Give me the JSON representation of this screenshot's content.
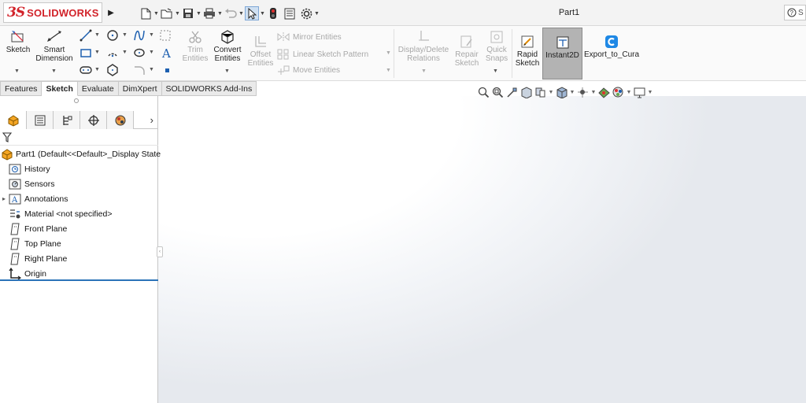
{
  "app": {
    "brand_prefix": "3S",
    "brand_name": "SOLIDWORKS",
    "document_title": "Part1",
    "help_hint": "S"
  },
  "ribbon": {
    "sketch": "Sketch",
    "smart_dimension_1": "Smart",
    "smart_dimension_2": "Dimension",
    "trim_1": "Trim",
    "trim_2": "Entities",
    "convert_1": "Convert",
    "convert_2": "Entities",
    "offset_1": "Offset",
    "offset_2": "Entities",
    "mirror": "Mirror Entities",
    "linear_pattern": "Linear Sketch Pattern",
    "move": "Move Entities",
    "display_delete_1": "Display/Delete",
    "display_delete_2": "Relations",
    "repair_1": "Repair",
    "repair_2": "Sketch",
    "quick_snaps_1": "Quick",
    "quick_snaps_2": "Snaps",
    "rapid_1": "Rapid",
    "rapid_2": "Sketch",
    "instant2d": "Instant2D",
    "export_cura": "Export_to_Cura"
  },
  "tabs": [
    "Features",
    "Sketch",
    "Evaluate",
    "DimXpert",
    "SOLIDWORKS Add-Ins"
  ],
  "active_tab": "Sketch",
  "tree": {
    "root": "Part1  (Default<<Default>_Display State",
    "items": [
      "History",
      "Sensors",
      "Annotations",
      "Material <not specified>",
      "Front Plane",
      "Top Plane",
      "Right Plane",
      "Origin"
    ]
  },
  "colors": {
    "brand_red": "#d2232a",
    "accent_blue": "#2b73b8",
    "cura_blue": "#1e88e5"
  }
}
